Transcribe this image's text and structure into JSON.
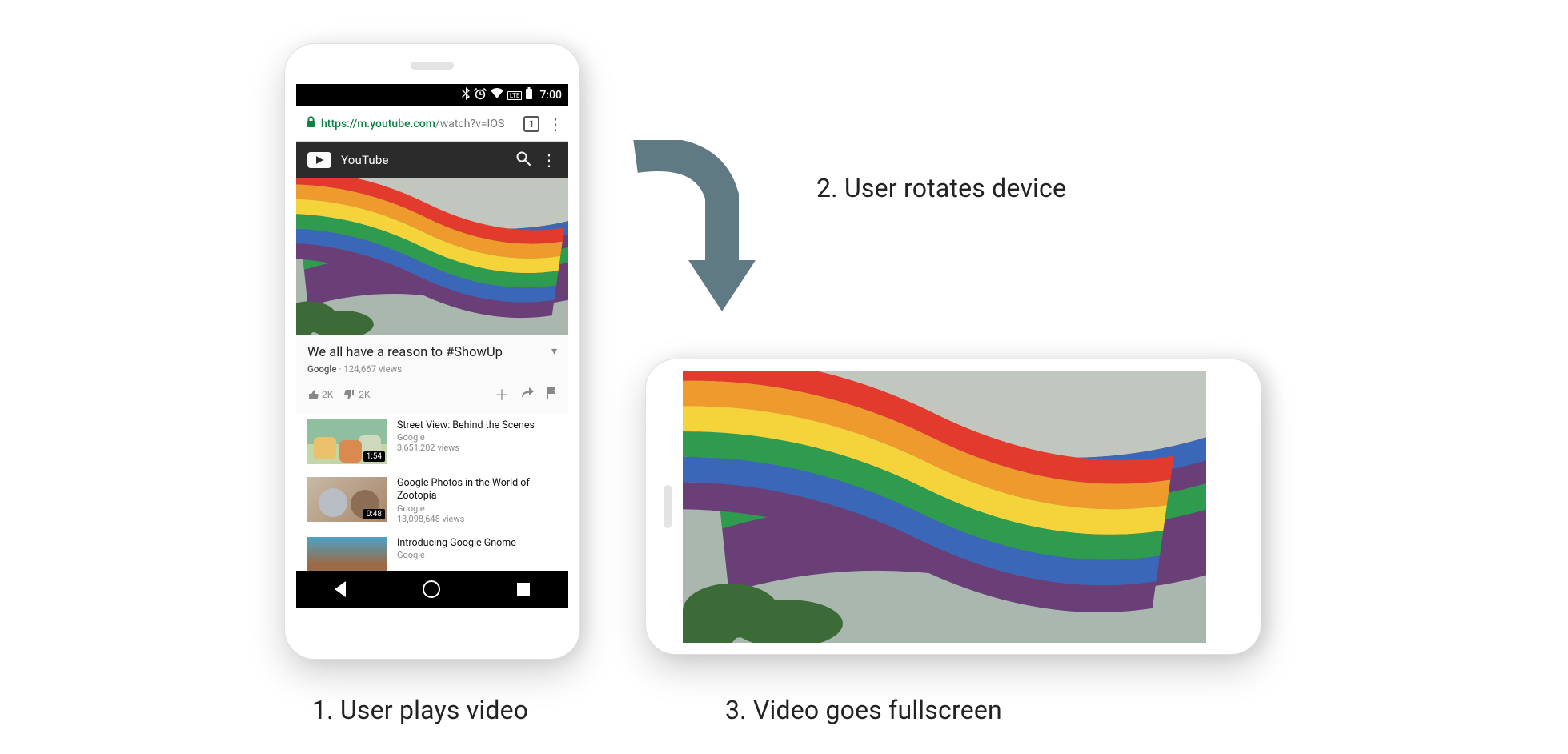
{
  "captions": {
    "step1": "1. User plays video",
    "step2": "2. User rotates device",
    "step3": "3. Video goes fullscreen"
  },
  "status_bar": {
    "time": "7:00",
    "icons": {
      "bluetooth": "bluetooth-icon",
      "alarm": "alarm-icon",
      "wifi": "wifi-icon",
      "lte": "LTE",
      "battery": "battery-icon"
    }
  },
  "chrome": {
    "lock_icon": "lock-icon",
    "url_domain": "https://m.youtube.com",
    "url_path": "/watch?v=IOS",
    "tabs_count": "1",
    "menu_icon": "more-vert-icon"
  },
  "yt_header": {
    "brand": "YouTube",
    "search_icon": "search-icon",
    "menu_icon": "more-vert-icon"
  },
  "video": {
    "title": "We all have a reason to #ShowUp",
    "channel": "Google",
    "views": "124,667 views",
    "likes": "2K",
    "dislikes": "2K"
  },
  "related": [
    {
      "title": "Street View: Behind the Scenes",
      "channel": "Google",
      "views": "3,651,202 views",
      "duration": "1:54"
    },
    {
      "title": "Google Photos in the World of Zootopia",
      "channel": "Google",
      "views": "13,098,648 views",
      "duration": "0:48"
    },
    {
      "title": "Introducing Google Gnome",
      "channel": "Google",
      "views": "",
      "duration": ""
    }
  ],
  "nav": {
    "back": "back-icon",
    "home": "home-icon",
    "recent": "recent-apps-icon"
  },
  "arrow_color": "#607a84"
}
